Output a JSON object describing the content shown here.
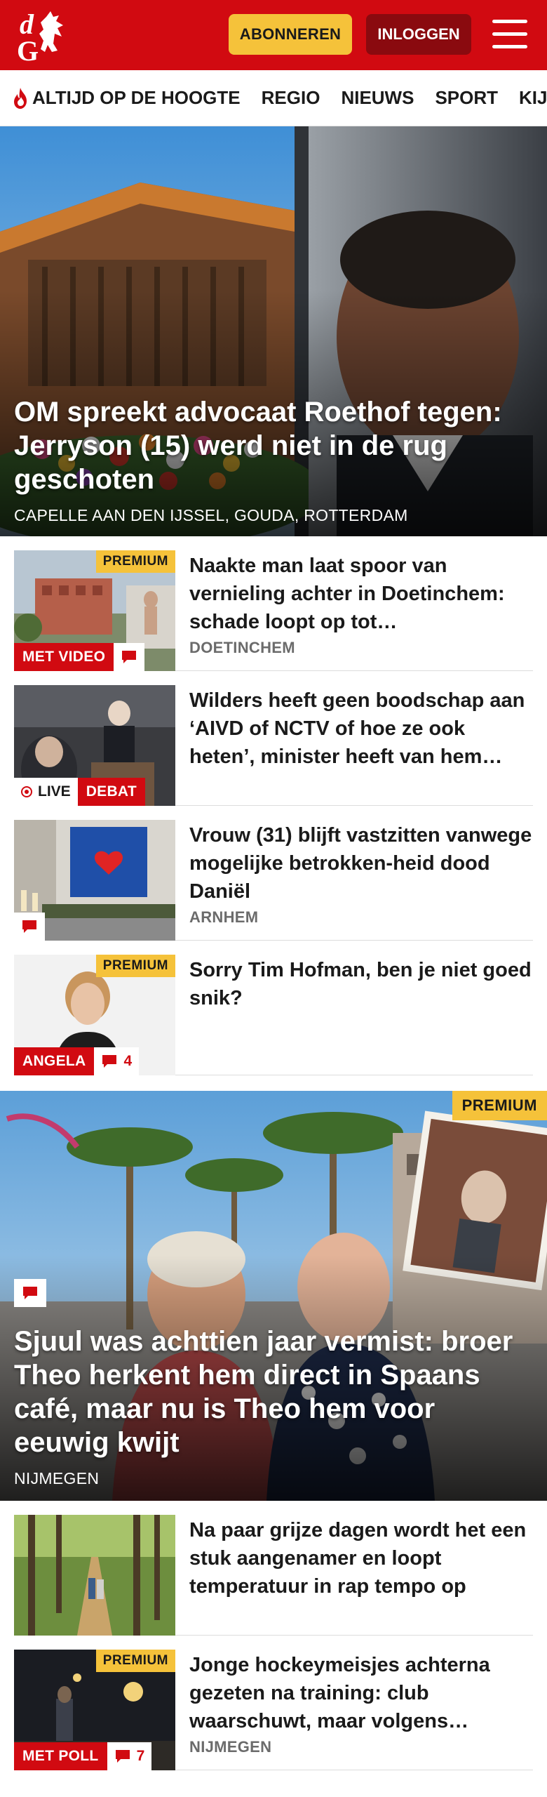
{
  "header": {
    "logo_text": "dG",
    "subscribe_label": "ABONNEREN",
    "login_label": "INLOGGEN",
    "menu_icon": "hamburger-icon",
    "colors": {
      "brand": "#d10a11",
      "subscribe": "#f5c23a",
      "login": "#8a0a0f"
    }
  },
  "nav": {
    "items": [
      {
        "label": "ALTIJD OP DE HOOGTE",
        "icon": "flame-icon"
      },
      {
        "label": "REGIO"
      },
      {
        "label": "NIEUWS"
      },
      {
        "label": "SPORT"
      },
      {
        "label": "KIJK"
      }
    ]
  },
  "hero": {
    "title": "OM spreekt advocaat Roethof tegen: Jerryson (15) werd niet in de rug geschoten",
    "location": "CAPELLE AAN DEN IJSSEL, GOUDA, ROTTERDAM"
  },
  "articles": [
    {
      "title": "Naakte man laat spoor van vernieling achter in Doetinchem: schade loopt op tot…",
      "location": "DOETINCHEM",
      "premium": "PREMIUM",
      "tag": "MET VIDEO",
      "comment_icon": "comment-icon"
    },
    {
      "title": "Wilders heeft geen boodschap aan ‘AIVD of NCTV of hoe ze ook heten’, minister heeft van hem…",
      "location": "",
      "live": "LIVE",
      "tag": "DEBAT"
    },
    {
      "title": "Vrouw (31) blijft vastzitten vanwege mogelijke betrokken-heid dood Daniël",
      "location": "ARNHEM",
      "comment_icon": "comment-icon"
    },
    {
      "title": "Sorry Tim Hofman, ben je niet goed snik?",
      "location": "",
      "premium": "PREMIUM",
      "tag": "ANGELA",
      "comment_count": "4"
    }
  ],
  "feature": {
    "title": "Sjuul was achttien jaar vermist: broer Theo herkent hem direct in Spaans café, maar nu is Theo hem voor eeuwig kwijt",
    "location": "NIJMEGEN",
    "premium": "PREMIUM"
  },
  "articles2": [
    {
      "title": "Na paar grijze dagen wordt het een stuk aangenamer en loopt temperatuur in rap tempo op",
      "location": ""
    },
    {
      "title": "Jonge hockeymeisjes achterna gezeten na training: club waarschuwt, maar volgens…",
      "location": "NIJMEGEN",
      "premium": "PREMIUM",
      "tag": "MET POLL",
      "comment_count": "7"
    }
  ]
}
